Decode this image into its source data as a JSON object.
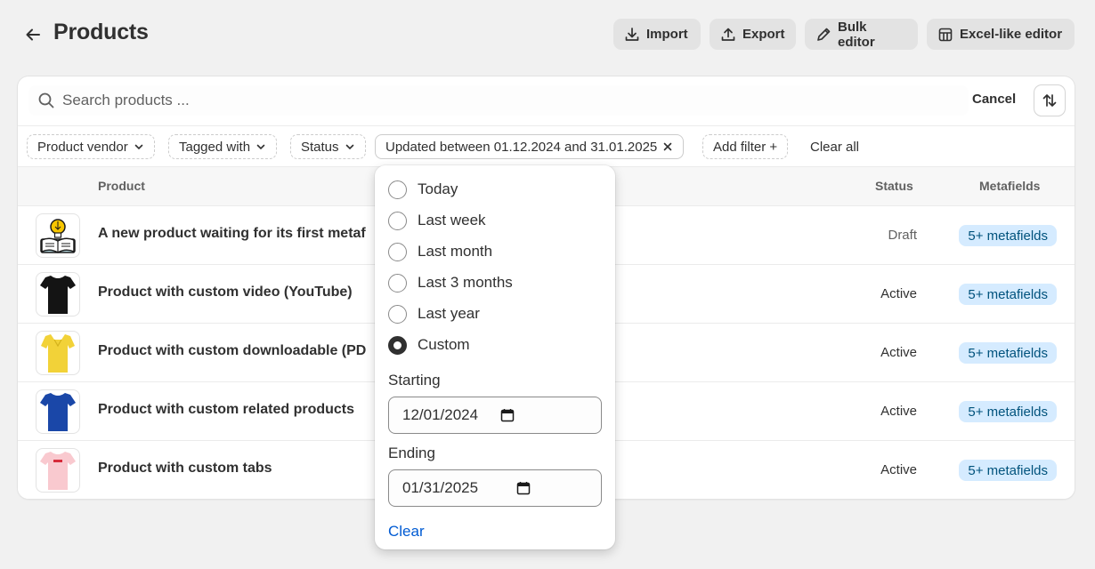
{
  "header": {
    "title": "Products",
    "import_label": "Import",
    "export_label": "Export",
    "bulk_editor_label": "Bulk editor",
    "excel_editor_label": "Excel-like editor"
  },
  "search": {
    "placeholder": "Search products ...",
    "cancel_label": "Cancel"
  },
  "filters": {
    "vendor": "Product vendor",
    "tagged": "Tagged with",
    "status": "Status",
    "updated": "Updated between 01.12.2024 and 31.01.2025",
    "add": "Add filter +",
    "clear_all": "Clear all"
  },
  "table": {
    "columns": {
      "product": "Product",
      "status": "Status",
      "metafields": "Metafields"
    },
    "rows": [
      {
        "name": "A new product waiting for its first metaf",
        "status": "Draft",
        "metafields": "5+ metafields",
        "image": "book-lightbulb"
      },
      {
        "name": "Product with custom video (YouTube)",
        "status": "Active",
        "metafields": "5+ metafields",
        "image": "black-tshirt"
      },
      {
        "name": "Product with custom downloadable (PD",
        "status": "Active",
        "metafields": "5+ metafields",
        "image": "yellow-polo"
      },
      {
        "name": "Product with custom related products",
        "status": "Active",
        "metafields": "5+ metafields",
        "image": "blue-tshirt"
      },
      {
        "name": "Product with custom tabs",
        "status": "Active",
        "metafields": "5+ metafields",
        "image": "pink-tshirt"
      }
    ]
  },
  "date_popover": {
    "options": [
      "Today",
      "Last week",
      "Last month",
      "Last 3 months",
      "Last year",
      "Custom"
    ],
    "selected": "Custom",
    "starting_label": "Starting",
    "starting_value": "12/01/2024",
    "ending_label": "Ending",
    "ending_value": "01/31/2025",
    "clear_label": "Clear"
  },
  "colors": {
    "page_bg": "#f1f1f1",
    "badge_bg": "#d5ebff",
    "badge_text": "#00527c",
    "link": "#005bd3"
  }
}
